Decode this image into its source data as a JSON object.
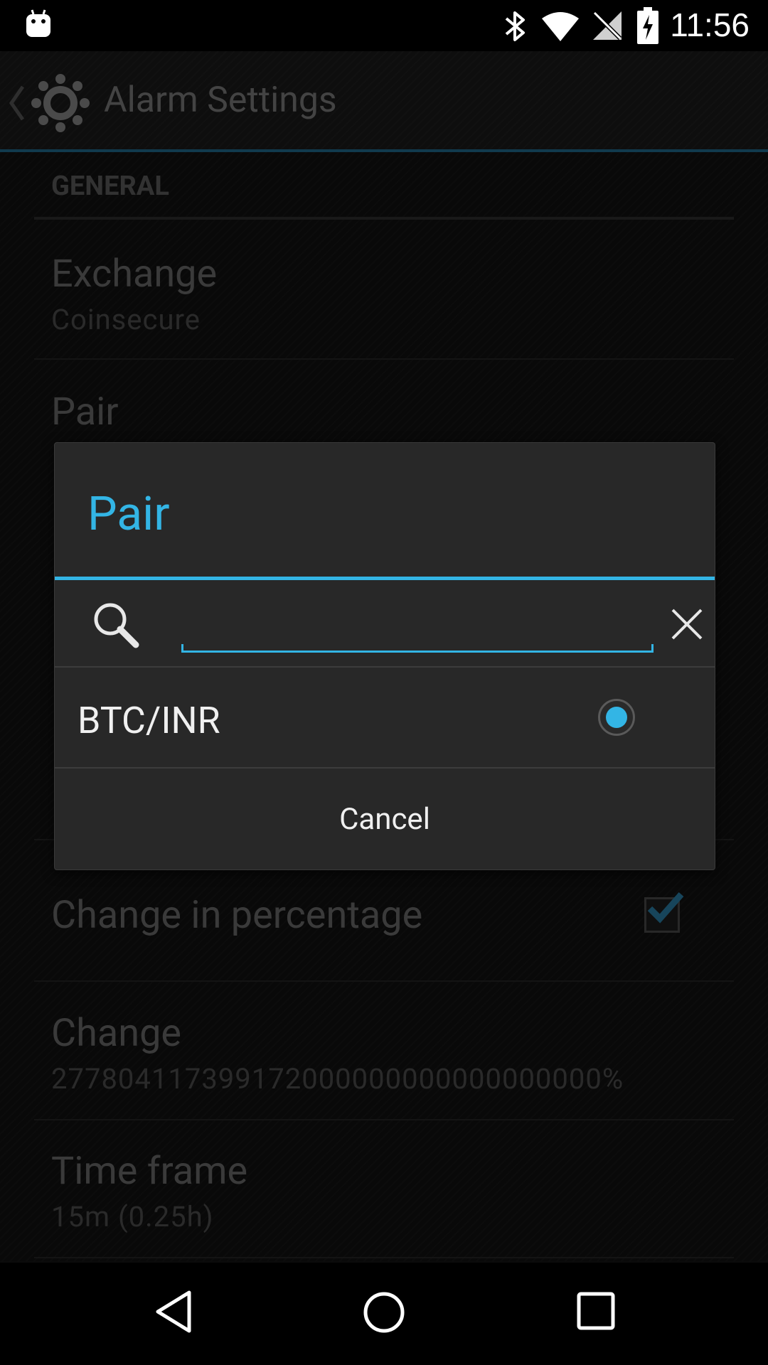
{
  "status_bar": {
    "time": "11:56",
    "icons": [
      "android-icon",
      "bluetooth-icon",
      "wifi-icon",
      "no-signal-icon",
      "battery-charging-icon"
    ]
  },
  "action_bar": {
    "title": "Alarm Settings",
    "back_icon": "chevron-left-icon",
    "app_icon": "gear-icon"
  },
  "preferences": {
    "section_header": "GENERAL",
    "exchange": {
      "title": "Exchange",
      "summary": "Coinsecure"
    },
    "pair": {
      "title": "Pair"
    },
    "change_in_percentage": {
      "title": "Change in percentage",
      "checked": true
    },
    "change": {
      "title": "Change",
      "summary": "277804117399172000000000000000000%"
    },
    "time_frame": {
      "title": "Time frame",
      "summary": "15m (0.25h)"
    }
  },
  "dialog": {
    "title": "Pair",
    "search": {
      "value": "",
      "placeholder": ""
    },
    "options": [
      {
        "label": "BTC/INR",
        "selected": true
      }
    ],
    "cancel_label": "Cancel"
  },
  "colors": {
    "accent": "#33b5e5",
    "background": "#121212",
    "dialog_background": "#282828"
  },
  "nav_bar": {
    "buttons": [
      "back-triangle-icon",
      "home-circle-icon",
      "recents-square-icon"
    ]
  }
}
